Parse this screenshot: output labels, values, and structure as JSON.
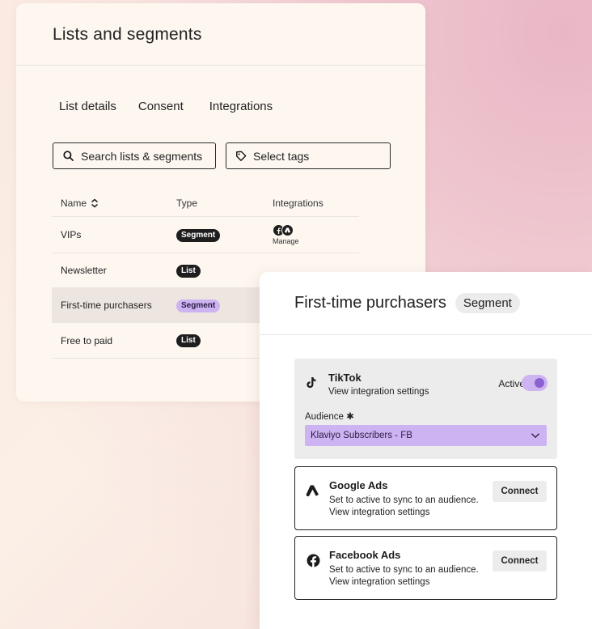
{
  "lists_panel": {
    "title": "Lists and segments",
    "tabs": [
      "List details",
      "Consent",
      "Integrations"
    ],
    "search_placeholder": "Search lists & segments",
    "tags_placeholder": "Select tags",
    "columns": [
      "Name",
      "Type",
      "Integrations"
    ],
    "rows": [
      {
        "name": "VIPs",
        "type": "Segment",
        "integrations_label": "Manage"
      },
      {
        "name": "Newsletter",
        "type": "List"
      },
      {
        "name": "First-time purchasers",
        "type": "Segment"
      },
      {
        "name": "Free to paid",
        "type": "List"
      }
    ]
  },
  "detail_panel": {
    "title": "First-time purchasers",
    "badge": "Segment",
    "tiktok": {
      "name": "TikTok",
      "subtitle": "View integration settings",
      "status": "Active",
      "audience_label": "Audience ✱",
      "audience_value": "Klaviyo Subscribers - FB"
    },
    "google": {
      "name": "Google Ads",
      "line1": "Set to active to sync to an audience.",
      "line2": "View integration settings",
      "button": "Connect"
    },
    "facebook": {
      "name": "Facebook Ads",
      "line1": "Set to active to sync to an audience.",
      "line2": "View integration settings",
      "button": "Connect"
    }
  },
  "colors": {
    "accent_purple": "#cdb3f1",
    "toggle_knob": "#8b62cf",
    "dark_pill": "#1e1e1e"
  }
}
